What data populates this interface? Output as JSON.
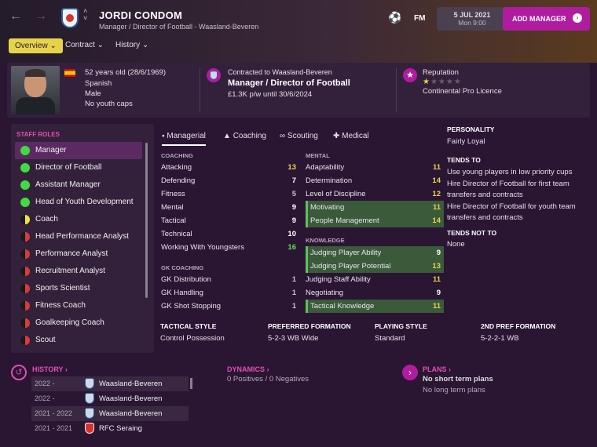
{
  "header": {
    "name": "JORDI CONDOM",
    "subtitle": "Manager / Director of Football - Waasland-Beveren",
    "fm_label": "FM",
    "date": "5 JUL 2021",
    "time": "Mon 9:00",
    "add_manager": "ADD MANAGER"
  },
  "tabs": {
    "overview": "Overview",
    "contract": "Contract",
    "history": "History"
  },
  "profile": {
    "age": "52 years old (28/6/1969)",
    "nationality": "Spanish",
    "gender": "Male",
    "caps": "No youth caps"
  },
  "contract": {
    "label": "Contracted to Waasland-Beveren",
    "role": "Manager / Director of Football",
    "wage": "£1.3K p/w until 30/6/2024"
  },
  "reputation": {
    "label": "Reputation",
    "stars": 1.5,
    "licence": "Continental Pro Licence"
  },
  "staff_roles": {
    "title": "STAFF ROLES",
    "items": [
      "Manager",
      "Director of Football",
      "Assistant Manager",
      "Head of Youth Development",
      "Coach",
      "Head Performance Analyst",
      "Performance Analyst",
      "Recruitment Analyst",
      "Sports Scientist",
      "Fitness Coach",
      "Goalkeeping Coach",
      "Scout"
    ]
  },
  "attr_tabs": [
    "Managerial",
    "Coaching",
    "Scouting",
    "Medical"
  ],
  "coaching": {
    "title": "COACHING",
    "items": [
      [
        "Attacking",
        "13"
      ],
      [
        "Defending",
        "7"
      ],
      [
        "Fitness",
        "5"
      ],
      [
        "Mental",
        "9"
      ],
      [
        "Tactical",
        "9"
      ],
      [
        "Technical",
        "10"
      ],
      [
        "Working With Youngsters",
        "16"
      ]
    ]
  },
  "gk": {
    "title": "GK COACHING",
    "items": [
      [
        "GK Distribution",
        "1"
      ],
      [
        "GK Handling",
        "1"
      ],
      [
        "GK Shot Stopping",
        "1"
      ]
    ]
  },
  "mental": {
    "title": "MENTAL",
    "items": [
      [
        "Adaptability",
        "11"
      ],
      [
        "Determination",
        "14"
      ],
      [
        "Level of Discipline",
        "12"
      ],
      [
        "Motivating",
        "11"
      ],
      [
        "People Management",
        "14"
      ]
    ]
  },
  "knowledge": {
    "title": "KNOWLEDGE",
    "items": [
      [
        "Judging Player Ability",
        "9"
      ],
      [
        "Judging Player Potential",
        "13"
      ],
      [
        "Judging Staff Ability",
        "11"
      ],
      [
        "Negotiating",
        "9"
      ],
      [
        "Tactical Knowledge",
        "11"
      ]
    ]
  },
  "personality": {
    "title": "PERSONALITY",
    "value": "Fairly Loyal"
  },
  "tends": {
    "title": "TENDS TO",
    "items": [
      "Use young players in low priority cups",
      "Hire Director of Football for first team transfers and contracts",
      "Hire Director of Football for youth team transfers and contracts"
    ]
  },
  "tends_not": {
    "title": "TENDS NOT TO",
    "value": "None"
  },
  "style": {
    "tactical_label": "TACTICAL STYLE",
    "tactical": "Control Possession",
    "formation_label": "PREFERRED FORMATION",
    "formation": "5-2-3 WB Wide",
    "playing_label": "PLAYING STYLE",
    "playing": "Standard",
    "second_label": "2ND PREF FORMATION",
    "second": "5-2-2-1 WB"
  },
  "history": {
    "title": "HISTORY ›",
    "rows": [
      [
        "2022 -",
        "Waasland-Beveren"
      ],
      [
        "2022 -",
        "Waasland-Beveren"
      ],
      [
        "2021 - 2022",
        "Waasland-Beveren"
      ],
      [
        "2021 - 2021",
        "RFC Seraing"
      ]
    ]
  },
  "dynamics": {
    "title": "DYNAMICS ›",
    "positives": "0 Positives",
    "slash": "/",
    "negatives": "0 Negatives"
  },
  "plans": {
    "title": "PLANS ›",
    "short": "No short term plans",
    "long": "No long term plans"
  },
  "colors": {
    "accent": "#b01c9f",
    "highlight": "#e7d34a",
    "green": "#3fdc3f"
  }
}
